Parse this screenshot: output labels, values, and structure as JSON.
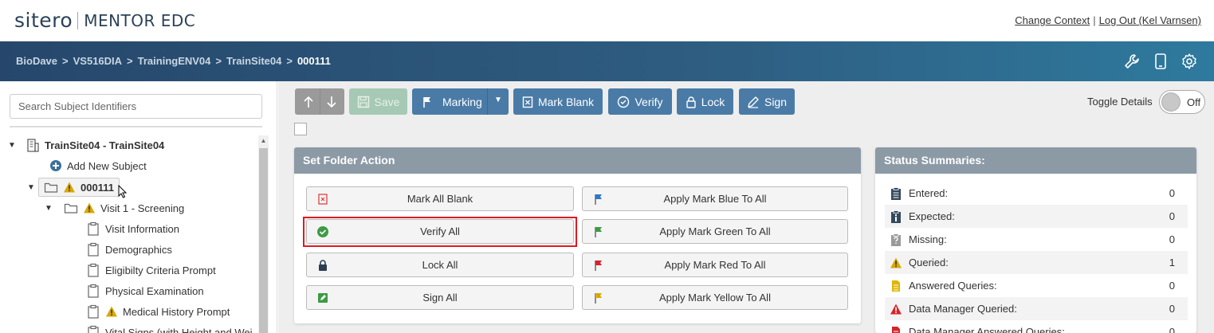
{
  "header": {
    "brand": "sitero",
    "product": "MENTOR EDC",
    "change_context": "Change Context",
    "separator": "|",
    "logout": "Log Out (Kel Varnsen)"
  },
  "breadcrumb": {
    "items": [
      "BioDave",
      "VS516DIA",
      "TrainingENV04",
      "TrainSite04"
    ],
    "current": "000111",
    "sep": ">"
  },
  "sidebar": {
    "search_placeholder": "Search Subject Identifiers",
    "site": "TrainSite04 - TrainSite04",
    "add_subject": "Add New Subject",
    "subject": "000111",
    "visit": "Visit 1 - Screening",
    "forms": [
      "Visit Information",
      "Demographics",
      "Eligibilty Criteria Prompt",
      "Physical Examination",
      "Medical History Prompt",
      "Vital Signs (with Height and Wei"
    ]
  },
  "toolbar": {
    "save": "Save",
    "marking": "Marking",
    "mark_blank": "Mark Blank",
    "verify": "Verify",
    "lock": "Lock",
    "sign": "Sign",
    "toggle_label": "Toggle Details",
    "toggle_state": "Off"
  },
  "folder_action": {
    "title": "Set Folder Action",
    "left": [
      "Mark All Blank",
      "Verify All",
      "Lock All",
      "Sign All"
    ],
    "right": [
      "Apply Mark Blue To All",
      "Apply Mark Green To All",
      "Apply Mark Red To All",
      "Apply Mark Yellow To All"
    ]
  },
  "status": {
    "title": "Status Summaries:",
    "rows": [
      {
        "label": "Entered:",
        "count": "0"
      },
      {
        "label": "Expected:",
        "count": "0"
      },
      {
        "label": "Missing:",
        "count": "0"
      },
      {
        "label": "Queried:",
        "count": "1"
      },
      {
        "label": "Answered Queries:",
        "count": "0"
      },
      {
        "label": "Data Manager Queried:",
        "count": "0"
      },
      {
        "label": "Data Manager Answered Queries:",
        "count": "0"
      }
    ]
  },
  "colors": {
    "accent_blue": "#4a7ba7",
    "header_dark": "#26476b",
    "highlight_red": "#e0191f",
    "warning_yellow": "#d9a800"
  }
}
